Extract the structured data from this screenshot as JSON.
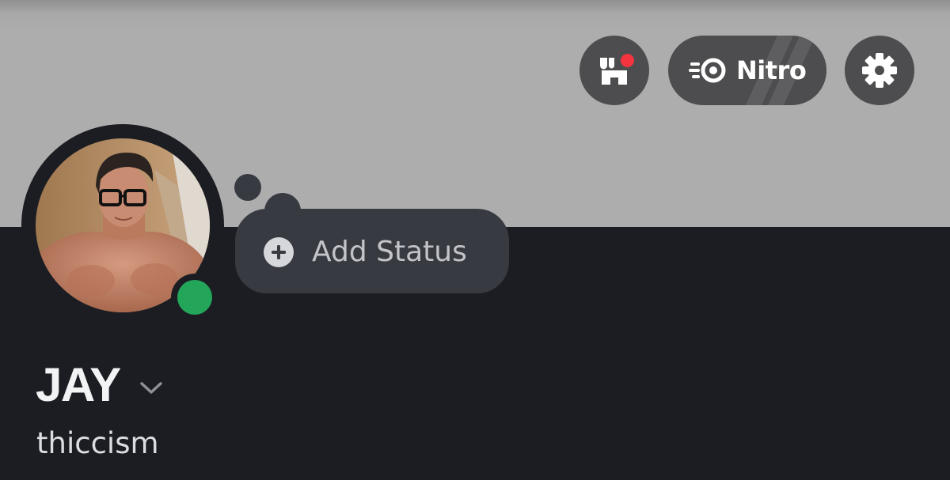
{
  "header": {
    "buttons": [
      {
        "name": "shop",
        "icon": "shop-icon",
        "has_notification": true
      },
      {
        "name": "nitro",
        "icon": "nitro-icon",
        "label": "Nitro"
      },
      {
        "name": "settings",
        "icon": "gear-icon"
      }
    ]
  },
  "profile": {
    "display_name": "JAY",
    "username": "thiccism",
    "presence": "online",
    "status_prompt": "Add Status"
  },
  "colors": {
    "banner": "#adadad",
    "background": "#1c1d22",
    "button": "#4d4d4f",
    "online": "#23a55a",
    "notification": "#f2353f",
    "status_bubble": "#383a42"
  }
}
